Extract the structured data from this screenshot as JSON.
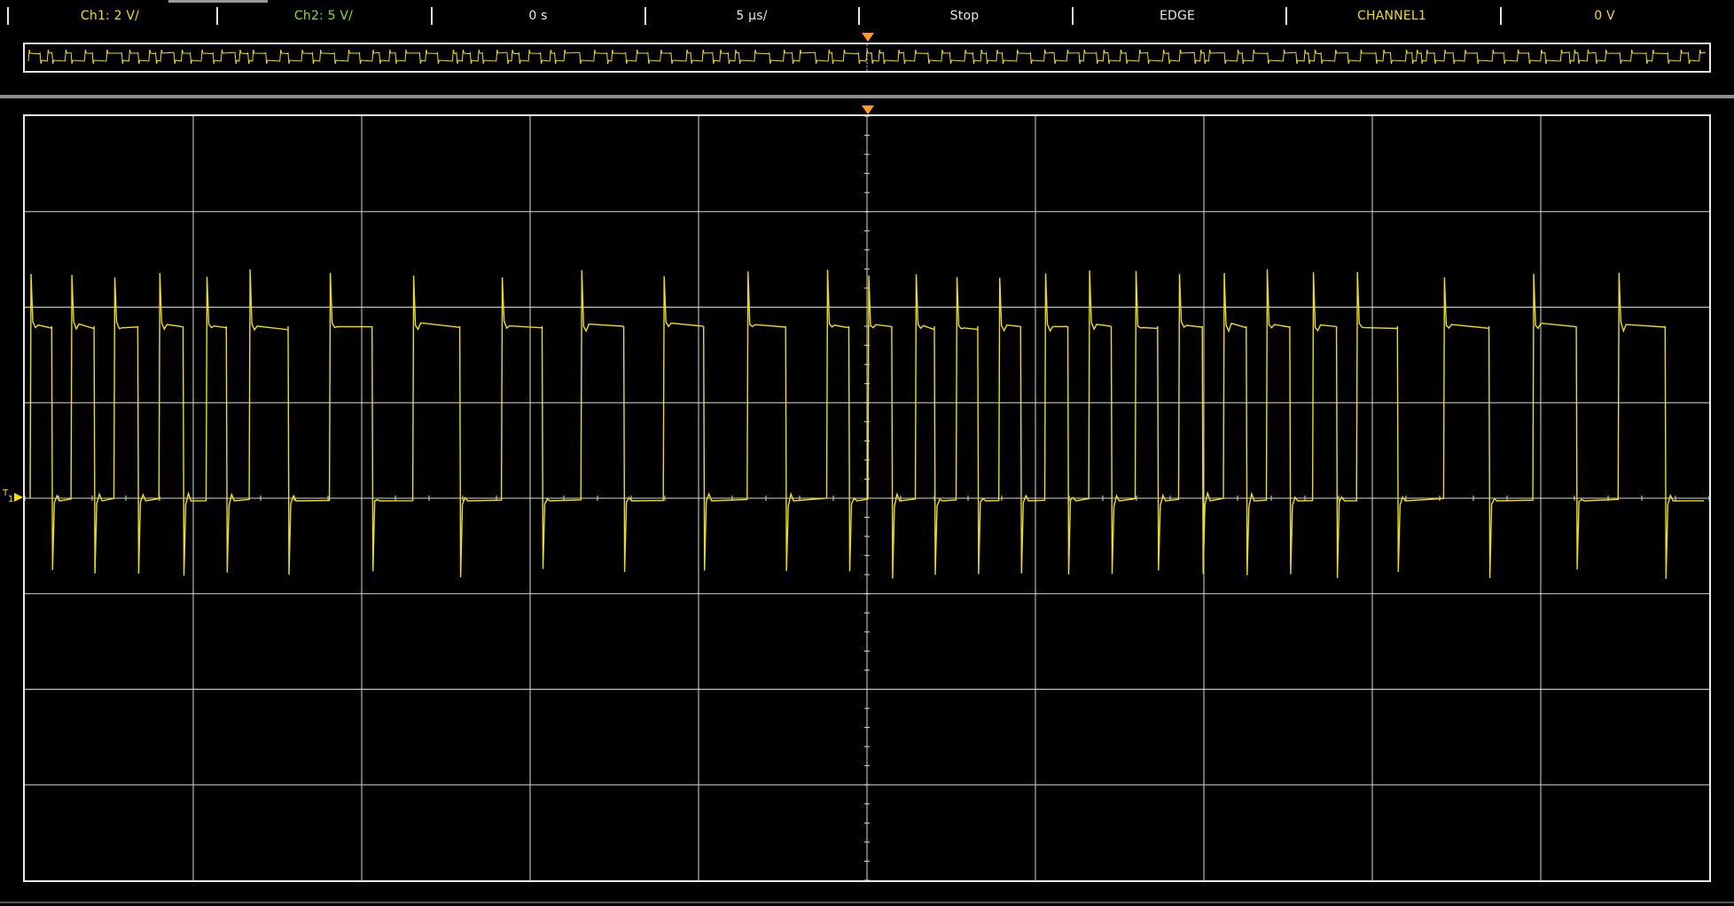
{
  "status_bar": {
    "items": [
      {
        "id": "ch1-scale",
        "label": "Ch1: 2 V/",
        "color": "#f0e000"
      },
      {
        "id": "ch2-scale",
        "label": "Ch2: 5 V/",
        "color": "#8fe01a"
      },
      {
        "id": "time-offset",
        "label": "0 s",
        "color": "#e8e8e8"
      },
      {
        "id": "time-scale",
        "label": "5 µs/",
        "color": "#e8e8e8"
      },
      {
        "id": "run-state",
        "label": "Stop",
        "color": "#e8e8e8"
      },
      {
        "id": "trigger-mode",
        "label": "EDGE",
        "color": "#e8e8e8"
      },
      {
        "id": "trigger-source",
        "label": "CHANNEL1",
        "color": "#f0e000"
      },
      {
        "id": "trigger-level",
        "label": "0 V",
        "color": "#f0e000"
      }
    ]
  },
  "scope": {
    "horizontal_divisions": 10,
    "vertical_divisions": 8,
    "ch1_color": "#f0e000",
    "grid_color": "#d8d8d8",
    "trigger_marker_color": "#ff9c1a",
    "trigger_position_division": 5,
    "channel1_ground_level_divisions_from_top": 4,
    "ch1_trace": {
      "high_level_divisions_above_ground": 1.8,
      "spike_high_divisions_above_ground": 2.4,
      "spike_low_divisions_below_ground": 0.85,
      "waveform_repeats_in_overview": 3,
      "pulses_per_division": 4
    },
    "ref_marker_icon": "channel1-ground-marker-icon"
  }
}
